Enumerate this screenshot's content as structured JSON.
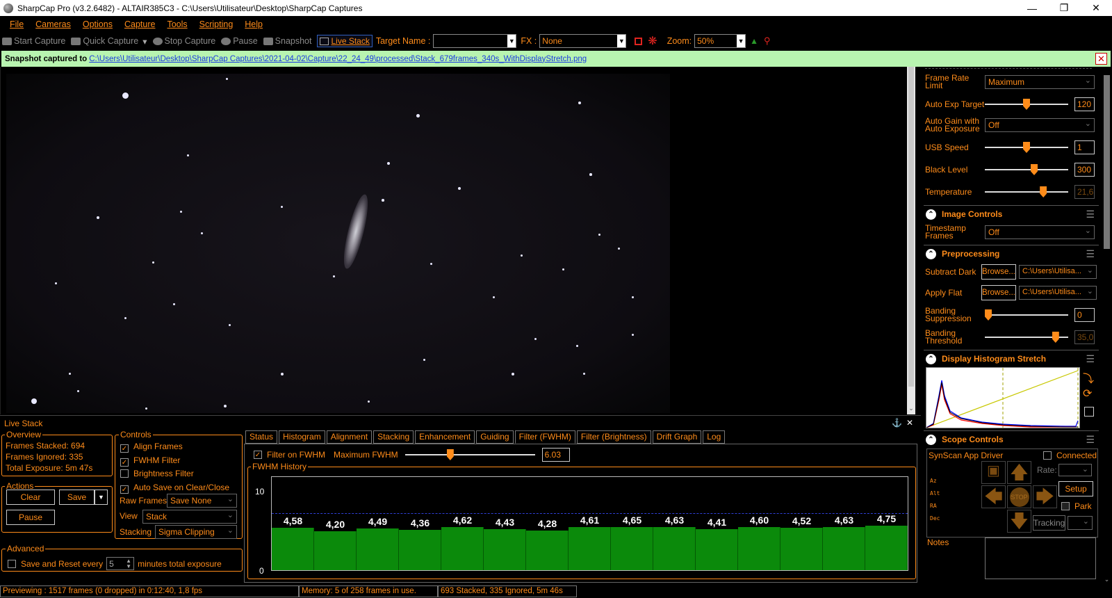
{
  "titlebar": {
    "title": "SharpCap Pro (v3.2.6482) - ALTAIR385C3 - C:\\Users\\Utilisateur\\Desktop\\SharpCap Captures",
    "min": "—",
    "max": "❐",
    "close": "✕"
  },
  "menu": [
    "File",
    "Cameras",
    "Options",
    "Capture",
    "Tools",
    "Scripting",
    "Help"
  ],
  "toolbar": {
    "start_capture": "Start Capture",
    "quick_capture": "Quick Capture",
    "stop_capture": "Stop Capture",
    "pause": "Pause",
    "snapshot": "Snapshot",
    "live_stack": "Live Stack",
    "target_name_label": "Target Name :",
    "target_name_value": "",
    "fx_label": "FX :",
    "fx_value": "None",
    "zoom_label": "Zoom:",
    "zoom_value": "50%"
  },
  "notification": {
    "prefix": "Snapshot captured to",
    "path": "C:\\Users\\Utilisateur\\Desktop\\SharpCap Captures\\2021-04-02\\Capture\\22_24_49\\processed\\Stack_679frames_340s_WithDisplayStretch.png",
    "close": "✕"
  },
  "camera_controls": {
    "frame_rate_limit": {
      "label": "Frame Rate Limit",
      "value": "Maximum"
    },
    "auto_exp_target": {
      "label": "Auto Exp Target",
      "value": "120",
      "level": 0.5
    },
    "auto_gain": {
      "label": "Auto Gain with Auto Exposure",
      "value": "Off"
    },
    "usb_speed": {
      "label": "USB Speed",
      "value": "1",
      "level": 0.5
    },
    "black_level": {
      "label": "Black Level",
      "value": "300",
      "level": 0.6
    },
    "temperature": {
      "label": "Temperature",
      "value": "21,6",
      "level": 0.72
    }
  },
  "image_controls": {
    "title": "Image Controls",
    "timestamp_frames": {
      "label": "Timestamp Frames",
      "value": "Off"
    }
  },
  "preprocessing": {
    "title": "Preprocessing",
    "subtract_dark": {
      "label": "Subtract Dark",
      "browse": "Browse...",
      "value": "C:\\Users\\Utilisa..."
    },
    "apply_flat": {
      "label": "Apply Flat",
      "browse": "Browse...",
      "value": "C:\\Users\\Utilisa..."
    },
    "banding_suppression": {
      "label": "Banding Suppression",
      "value": "0",
      "level": 0.0
    },
    "banding_threshold": {
      "label": "Banding Threshold",
      "value": "35,0",
      "level": 0.88
    }
  },
  "display_histogram": {
    "title": "Display Histogram Stretch"
  },
  "scope_controls": {
    "title": "Scope Controls",
    "driver": "SynScan App Driver",
    "connected": "Connected",
    "rate": "Rate:",
    "setup": "Setup",
    "park": "Park",
    "tracking": "Tracking",
    "stop": "STOP",
    "axes": [
      "Az",
      "Alt",
      "RA",
      "Dec"
    ],
    "notes": "Notes"
  },
  "live_stack": {
    "title": "Live Stack",
    "overview": {
      "title": "Overview",
      "frames_stacked_label": "Frames Stacked:",
      "frames_stacked": "694",
      "frames_ignored_label": "Frames Ignored:",
      "frames_ignored": "335",
      "total_exposure_label": "Total Exposure:",
      "total_exposure": "5m 47s"
    },
    "actions": {
      "title": "Actions",
      "clear": "Clear",
      "save": "Save",
      "pause": "Pause"
    },
    "controls": {
      "title": "Controls",
      "align_frames": "Align Frames",
      "fwhm_filter": "FWHM Filter",
      "brightness_filter": "Brightness Filter",
      "auto_save": "Auto Save on Clear/Close",
      "raw_frames_label": "Raw Frames",
      "raw_frames_value": "Save None",
      "view_label": "View",
      "view_value": "Stack",
      "stacking_label": "Stacking",
      "stacking_value": "Sigma Clipping"
    },
    "advanced": {
      "title": "Advanced",
      "save_reset_label": "Save and Reset every",
      "minutes_value": "5",
      "minutes_label": "minutes total exposure"
    },
    "tabs": [
      "Status",
      "Histogram",
      "Alignment",
      "Stacking",
      "Enhancement",
      "Guiding",
      "Filter (FWHM)",
      "Filter (Brightness)",
      "Drift Graph",
      "Log"
    ],
    "active_tab": "Filter (FWHM)",
    "filter": {
      "filter_on_label": "Filter on FWHM",
      "max_fwhm_label": "Maximum FWHM",
      "max_fwhm_value": "6.03",
      "max_fwhm_level": 0.34,
      "history_title": "FWHM History"
    }
  },
  "chart_data": {
    "type": "bar",
    "title": "FWHM History",
    "ylim": [
      0,
      10
    ],
    "yticks": [
      "10",
      "0"
    ],
    "threshold": 6.03,
    "labels": [
      "4,58",
      "4,20",
      "4,49",
      "4,36",
      "4,62",
      "4,43",
      "4,28",
      "4,61",
      "4,65",
      "4,63",
      "4,41",
      "4,60",
      "4,52",
      "4,63",
      "4,75"
    ],
    "values": [
      4.58,
      4.2,
      4.49,
      4.36,
      4.62,
      4.43,
      4.28,
      4.61,
      4.65,
      4.63,
      4.41,
      4.6,
      4.52,
      4.63,
      4.75
    ]
  },
  "statusbar": {
    "preview": "Previewing : 1517 frames (0 dropped) in 0:12:40, 1,8 fps",
    "memory": "Memory: 5 of 258 frames in use.",
    "stack": "693 Stacked, 335 Ignored, 5m 46s"
  },
  "colors": {
    "accent": "#ff8c1a",
    "bar": "#0b8a0b",
    "banner": "#b8f4b0",
    "link": "#1a3ce0"
  }
}
